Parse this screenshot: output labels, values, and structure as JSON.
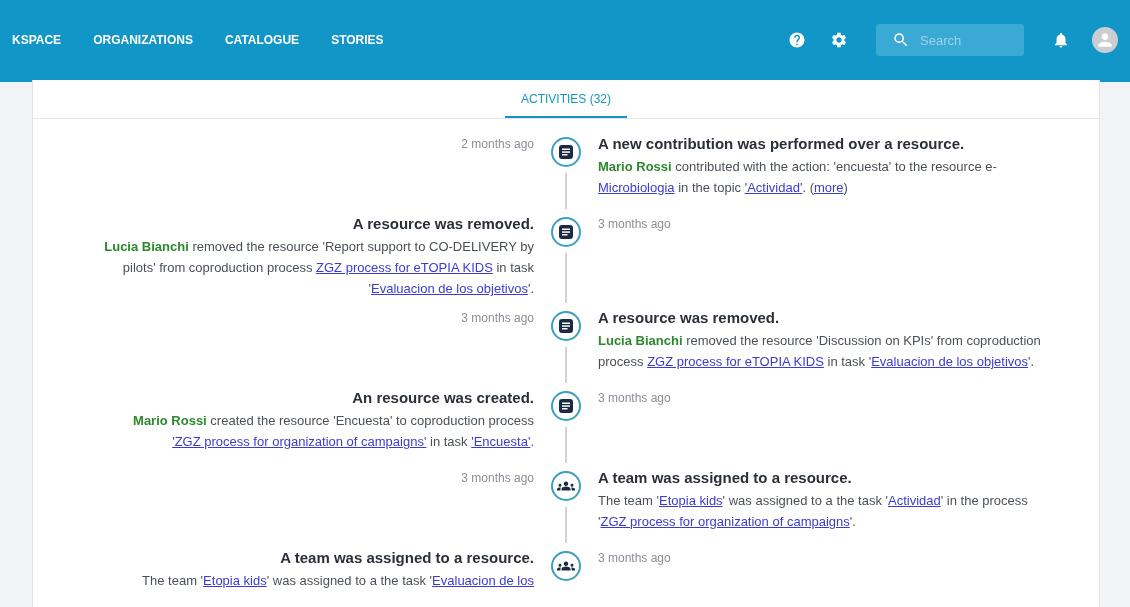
{
  "nav": {
    "items": [
      {
        "label": "KSPACE"
      },
      {
        "label": "ORGANIZATIONS"
      },
      {
        "label": "CATALOGUE"
      },
      {
        "label": "STORIES"
      }
    ],
    "search": {
      "placeholder": "Search"
    }
  },
  "tabs": [
    {
      "label": "ACTIVITIES (32)",
      "selected": true
    }
  ],
  "activities": [
    {
      "time": "2 months ago",
      "kind": "document",
      "title": "A new contribution was performed over a resource.",
      "body": [
        {
          "kind": "user",
          "text": "Mario Rossi"
        },
        {
          "kind": "text",
          "text": " contributed with the action: 'encuesta' to the resource e-"
        },
        {
          "kind": "link",
          "text": "Microbiologia"
        },
        {
          "kind": "text",
          "text": " in the topic "
        },
        {
          "kind": "link",
          "text": "'Actividad'"
        },
        {
          "kind": "text",
          "text": ". ("
        },
        {
          "kind": "link",
          "text": "more"
        },
        {
          "kind": "text",
          "text": ")"
        }
      ]
    },
    {
      "time": "3 months ago",
      "kind": "document",
      "title": "A resource was removed.",
      "body": [
        {
          "kind": "user",
          "text": "Lucia Bianchi"
        },
        {
          "kind": "text",
          "text": " removed the resource 'Report support to CO-DELIVERY by pilots' from coproduction process "
        },
        {
          "kind": "link",
          "text": "ZGZ process for eTOPIA KIDS"
        },
        {
          "kind": "text",
          "text": " in task '"
        },
        {
          "kind": "link",
          "text": "Evaluacion de los objetivos"
        },
        {
          "kind": "text",
          "text": "'."
        }
      ]
    },
    {
      "time": "3 months ago",
      "kind": "document",
      "title": "A resource was removed.",
      "body": [
        {
          "kind": "user",
          "text": "Lucia Bianchi"
        },
        {
          "kind": "text",
          "text": " removed the resource 'Discussion on KPIs' from coproduction process "
        },
        {
          "kind": "link",
          "text": "ZGZ process for eTOPIA KIDS"
        },
        {
          "kind": "text",
          "text": " in task '"
        },
        {
          "kind": "link",
          "text": "Evaluacion de los objetivos"
        },
        {
          "kind": "text",
          "text": "'."
        }
      ]
    },
    {
      "time": "3 months ago",
      "kind": "document",
      "title": "An resource was created.",
      "body": [
        {
          "kind": "user",
          "text": "Mario Rossi"
        },
        {
          "kind": "text",
          "text": " created the resource 'Encuesta' to coproduction process "
        },
        {
          "kind": "link",
          "text": "'ZGZ process for organization of campaigns'"
        },
        {
          "kind": "text",
          "text": " in task "
        },
        {
          "kind": "link",
          "text": "'Encuesta'"
        },
        {
          "kind": "text",
          "text": "."
        }
      ]
    },
    {
      "time": "3 months ago",
      "kind": "team",
      "title": "A team was assigned to a resource.",
      "body": [
        {
          "kind": "text",
          "text": "The team '"
        },
        {
          "kind": "link",
          "text": "Etopia kids"
        },
        {
          "kind": "text",
          "text": "' was assigned to a the task '"
        },
        {
          "kind": "link",
          "text": "Actividad"
        },
        {
          "kind": "text",
          "text": "' in the process '"
        },
        {
          "kind": "link",
          "text": "ZGZ process for organization of campaigns"
        },
        {
          "kind": "text",
          "text": "'."
        }
      ]
    },
    {
      "time": "3 months ago",
      "kind": "team",
      "title": "A team was assigned to a resource.",
      "body": [
        {
          "kind": "text",
          "text": "The team '"
        },
        {
          "kind": "link",
          "text": "Etopia kids"
        },
        {
          "kind": "text",
          "text": "' was assigned to a the task '"
        },
        {
          "kind": "link",
          "text": "Evaluacion de los"
        }
      ]
    }
  ]
}
